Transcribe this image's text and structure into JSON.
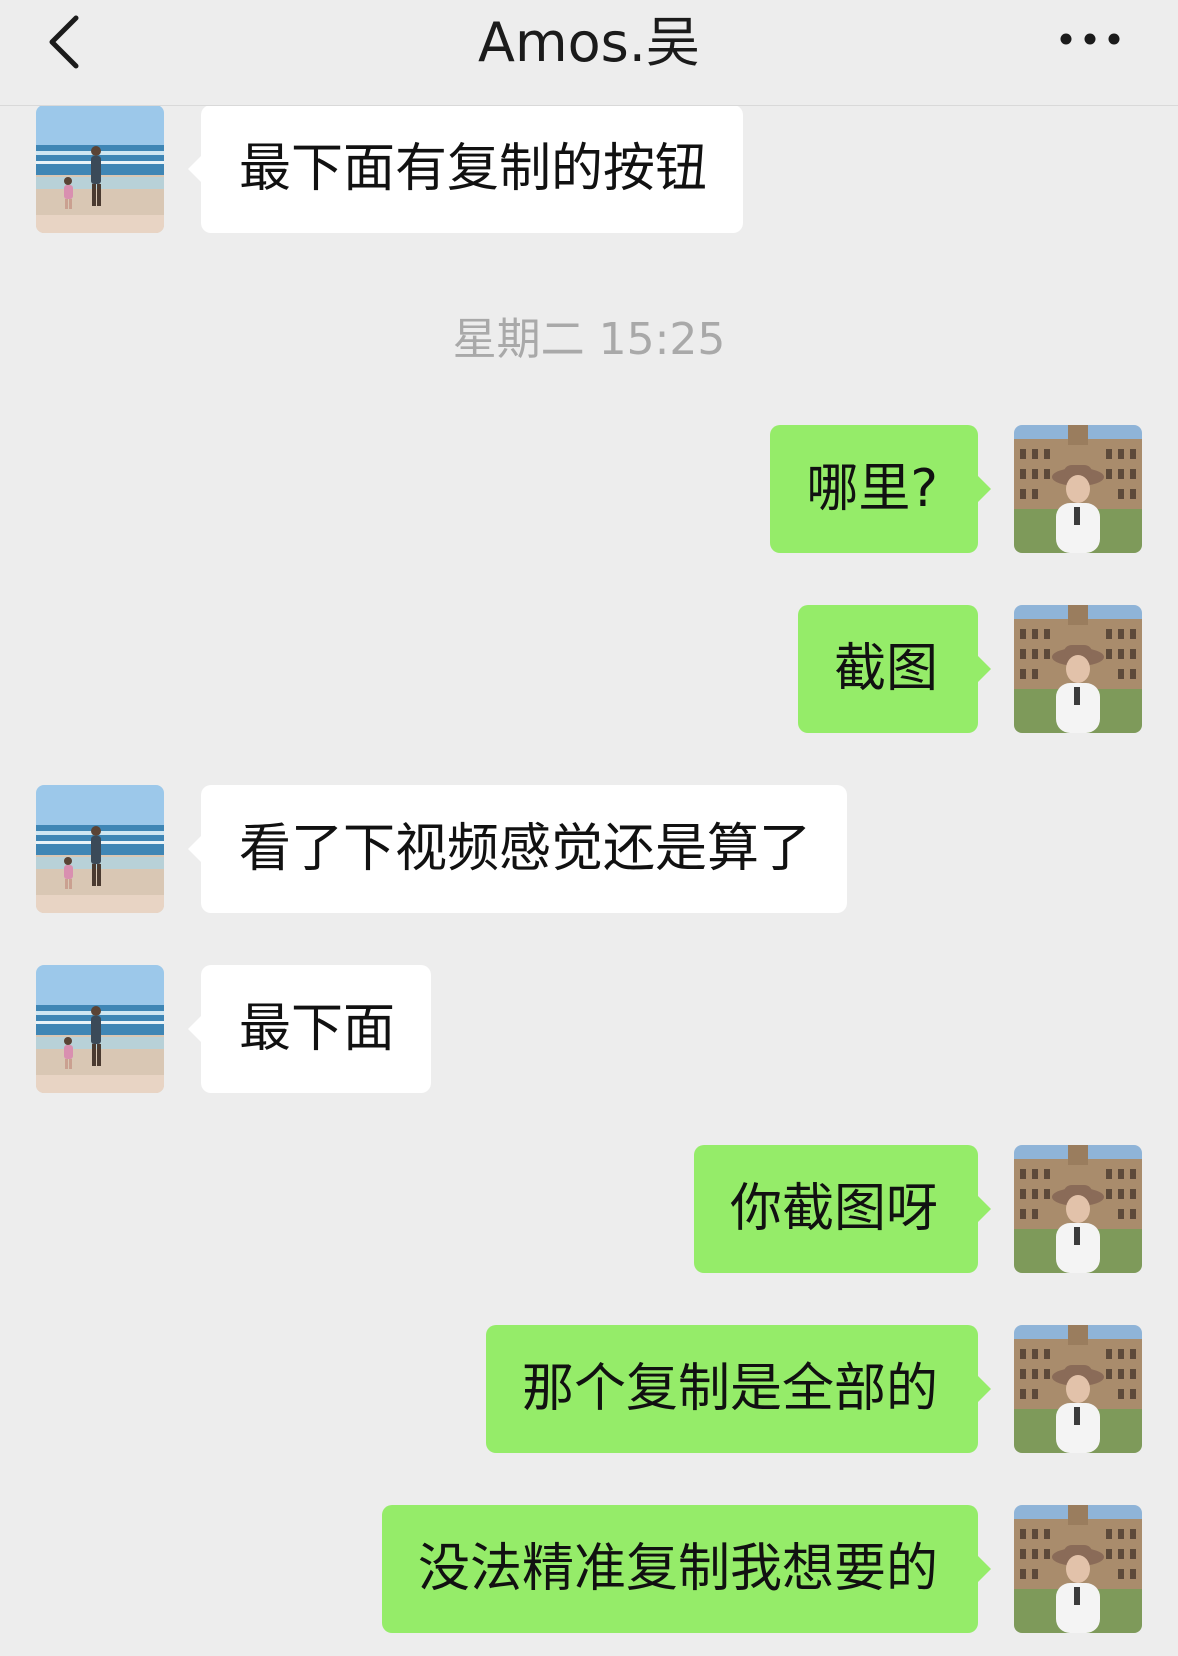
{
  "header": {
    "title": "Amos.吴",
    "back_icon": "chevron-left-icon",
    "more_icon": "more-dots-icon"
  },
  "colors": {
    "background": "#ededed",
    "incoming_bubble": "#ffffff",
    "outgoing_bubble": "#95ec69",
    "timestamp_text": "#a9a9a9"
  },
  "timestamp": "星期二 15:25",
  "messages": [
    {
      "direction": "incoming",
      "text": "最下面有复制的按钮"
    },
    {
      "direction": "outgoing",
      "text": "哪里?"
    },
    {
      "direction": "outgoing",
      "text": "截图"
    },
    {
      "direction": "incoming",
      "text": "看了下视频感觉还是算了"
    },
    {
      "direction": "incoming",
      "text": "最下面"
    },
    {
      "direction": "outgoing",
      "text": "你截图呀"
    },
    {
      "direction": "outgoing",
      "text": "那个复制是全部的"
    },
    {
      "direction": "outgoing",
      "text": "没法精准复制我想要的"
    }
  ]
}
